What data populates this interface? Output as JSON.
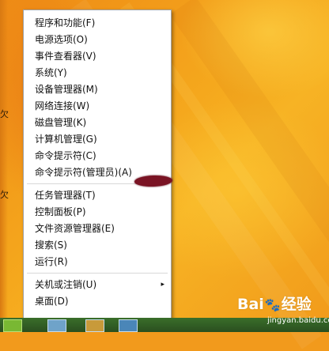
{
  "menu": {
    "items": [
      {
        "label": "程序和功能(F)"
      },
      {
        "label": "电源选项(O)"
      },
      {
        "label": "事件查看器(V)"
      },
      {
        "label": "系统(Y)"
      },
      {
        "label": "设备管理器(M)"
      },
      {
        "label": "网络连接(W)"
      },
      {
        "label": "磁盘管理(K)"
      },
      {
        "label": "计算机管理(G)"
      },
      {
        "label": "命令提示符(C)"
      },
      {
        "label": "命令提示符(管理员)(A)"
      },
      {
        "label": "任务管理器(T)"
      },
      {
        "label": "控制面板(P)"
      },
      {
        "label": "文件资源管理器(E)"
      },
      {
        "label": "搜索(S)"
      },
      {
        "label": "运行(R)"
      },
      {
        "label": "关机或注销(U)"
      },
      {
        "label": "桌面(D)"
      }
    ],
    "submenu_arrow": "▸"
  },
  "desktop": {
    "edge_labels": [
      "欠",
      "欠"
    ]
  },
  "watermark": {
    "brand": "Bai",
    "brand_suffix": "经验",
    "site": "jingyan.baidu.com"
  },
  "colors": {
    "annotation": "#7a1424",
    "wallpaper": "#f29a1c"
  }
}
